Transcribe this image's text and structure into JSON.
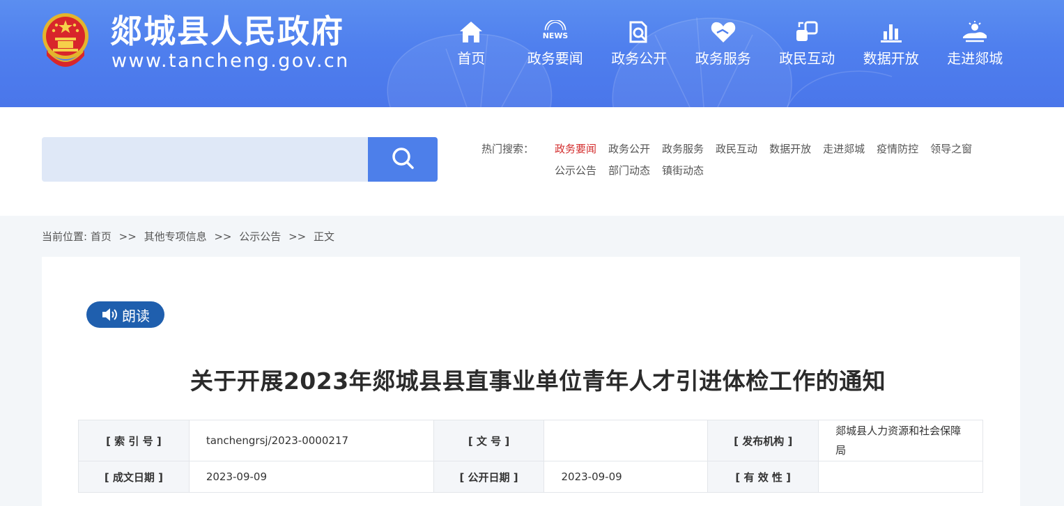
{
  "header": {
    "site_title": "郯城县人民政府",
    "site_url": "www.tancheng.gov.cn",
    "colors": {
      "header_bg": "#4f7fee",
      "accent": "#4d7fea",
      "active_link": "#d32d2d"
    },
    "nav": [
      {
        "label": "首页",
        "icon": "home-icon"
      },
      {
        "label": "政务要闻",
        "icon": "news-icon",
        "icon_text": "NEWS"
      },
      {
        "label": "政务公开",
        "icon": "document-search-icon"
      },
      {
        "label": "政务服务",
        "icon": "heart-hand-icon"
      },
      {
        "label": "政民互动",
        "icon": "interaction-icon"
      },
      {
        "label": "数据开放",
        "icon": "bar-chart-icon"
      },
      {
        "label": "走进郯城",
        "icon": "landscape-icon"
      }
    ]
  },
  "search": {
    "placeholder": "",
    "hot_label": "热门搜索：",
    "hot_links": [
      {
        "label": "政务要闻",
        "active": true
      },
      {
        "label": "政务公开"
      },
      {
        "label": "政务服务"
      },
      {
        "label": "政民互动"
      },
      {
        "label": "数据开放"
      },
      {
        "label": "走进郯城"
      },
      {
        "label": "疫情防控"
      },
      {
        "label": "领导之窗"
      },
      {
        "label": "公示公告"
      },
      {
        "label": "部门动态"
      },
      {
        "label": "镇街动态"
      }
    ]
  },
  "breadcrumb": {
    "prefix": "当前位置:",
    "separator": ">>",
    "items": [
      "首页",
      "其他专项信息",
      "公示公告",
      "正文"
    ]
  },
  "article": {
    "read_button": "朗读",
    "title": "关于开展2023年郯城县县直事业单位青年人才引进体检工作的通知",
    "meta": {
      "index_label": "[ 索  引  号 ]",
      "index_value": "tanchengrsj/2023-0000217",
      "docno_label": "[ 文        号 ]",
      "docno_value": "",
      "publisher_label": "[ 发布机构 ]",
      "publisher_value": "郯城县人力资源和社会保障局",
      "created_label": "[ 成文日期 ]",
      "created_value": "2023-09-09",
      "published_label": "[ 公开日期 ]",
      "published_value": "2023-09-09",
      "validity_label": "[ 有  效  性 ]",
      "validity_value": ""
    }
  }
}
